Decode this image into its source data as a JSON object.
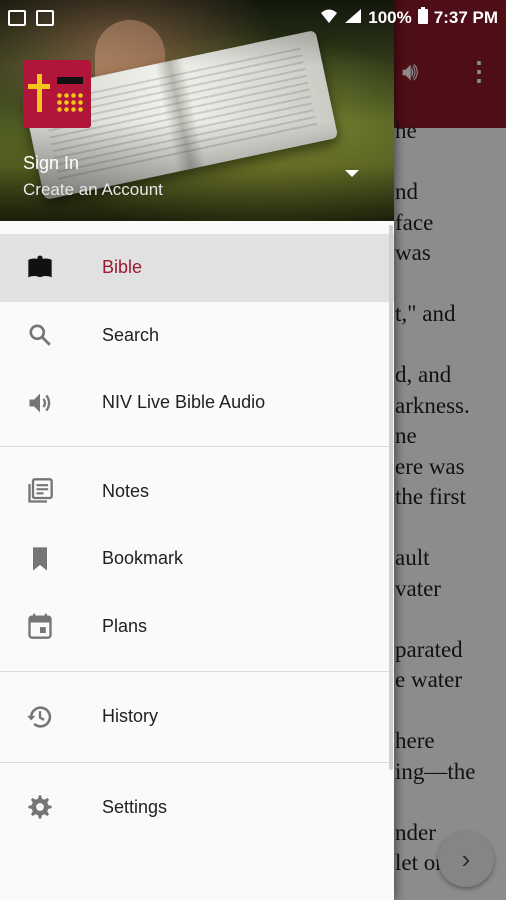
{
  "status_bar": {
    "battery": "100%",
    "time": "7:37 PM"
  },
  "drawer": {
    "header": {
      "sign_in": "Sign In",
      "create_account": "Create an Account"
    },
    "groups": [
      [
        {
          "label": "Bible",
          "icon": "bible-icon",
          "active": true
        },
        {
          "label": "Search",
          "icon": "search-icon",
          "active": false
        },
        {
          "label": "NIV Live Bible Audio",
          "icon": "speaker-icon",
          "active": false
        }
      ],
      [
        {
          "label": "Notes",
          "icon": "notes-icon",
          "active": false
        },
        {
          "label": "Bookmark",
          "icon": "bookmark-icon",
          "active": false
        },
        {
          "label": "Plans",
          "icon": "calendar-icon",
          "active": false
        }
      ],
      [
        {
          "label": "History",
          "icon": "history-icon",
          "active": false
        }
      ],
      [
        {
          "label": "Settings",
          "icon": "gear-icon",
          "active": false
        }
      ]
    ]
  },
  "background_text": [
    "he",
    "",
    "nd",
    "face",
    "was",
    "",
    "t,\" and",
    "",
    "d, and",
    "arkness.",
    "ne",
    "ere was",
    "the first",
    "",
    "ault",
    "vater",
    "",
    "parated",
    "e water",
    "",
    "here",
    "ing—the",
    "",
    "nder",
    "let ory"
  ],
  "colors": {
    "accent": "#9b1b30",
    "toolbar": "#8e1b2b"
  }
}
